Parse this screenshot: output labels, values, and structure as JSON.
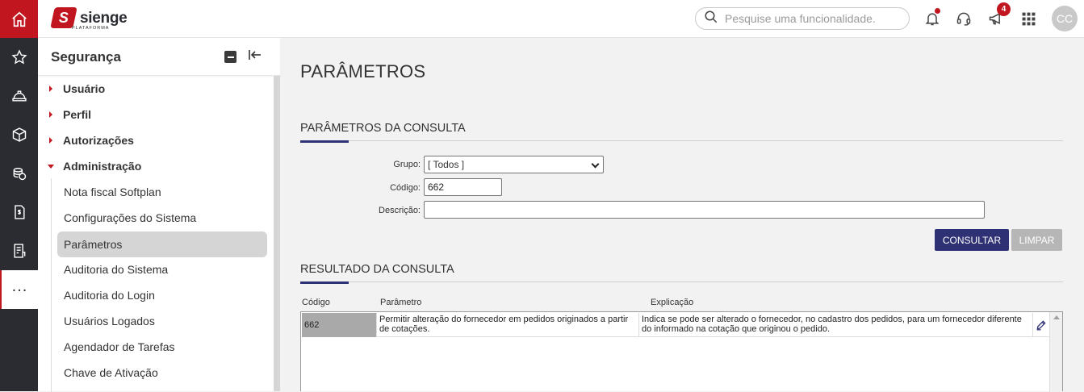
{
  "app": {
    "brand": "sienge",
    "brand_sub": "PLATAFORMA"
  },
  "topbar": {
    "search_placeholder": "Pesquise uma funcionalidade.",
    "notifications_badge": "4",
    "avatar_initials": "CC"
  },
  "rail": {
    "icons": [
      "home-icon",
      "star-icon",
      "helmet-icon",
      "box-icon",
      "coins-icon",
      "document-dollar-icon",
      "receipt-icon",
      "more-icon"
    ],
    "more_label": "..."
  },
  "sidebar": {
    "title": "Segurança",
    "groups": [
      {
        "label": "Usuário",
        "expanded": false
      },
      {
        "label": "Perfil",
        "expanded": false
      },
      {
        "label": "Autorizações",
        "expanded": false
      },
      {
        "label": "Administração",
        "expanded": true
      }
    ],
    "items": [
      {
        "label": "Nota fiscal Softplan",
        "active": false
      },
      {
        "label": "Configurações do Sistema",
        "active": false
      },
      {
        "label": "Parâmetros",
        "active": true
      },
      {
        "label": "Auditoria do Sistema",
        "active": false
      },
      {
        "label": "Auditoria do Login",
        "active": false
      },
      {
        "label": "Usuários Logados",
        "active": false
      },
      {
        "label": "Agendador de Tarefas",
        "active": false
      },
      {
        "label": "Chave de Ativação",
        "active": false
      }
    ]
  },
  "main": {
    "title": "PARÂMETROS",
    "query_section": "PARÂMETROS DA CONSULTA",
    "form": {
      "grupo_label": "Grupo:",
      "grupo_value": "[ Todos ]",
      "codigo_label": "Código:",
      "codigo_value": "662",
      "descricao_label": "Descrição:",
      "descricao_value": ""
    },
    "buttons": {
      "consultar": "CONSULTAR",
      "limpar": "LIMPAR"
    },
    "result_section": "RESULTADO DA CONSULTA",
    "table": {
      "headers": [
        "Código",
        "Parâmetro",
        "Explicação"
      ],
      "rows": [
        {
          "codigo": "662",
          "parametro": "Permitir alteração do fornecedor em pedidos originados a partir de cotações.",
          "explicacao": "Indica se pode ser alterado o fornecedor, no cadastro dos pedidos, para um fornecedor diferente do informado na cotação que originou o pedido."
        }
      ]
    }
  },
  "colors": {
    "brand_red": "#c1161f",
    "rail_dark": "#2a2c32",
    "primary_button": "#2e3173",
    "disabled_button": "#b6b6b6"
  }
}
